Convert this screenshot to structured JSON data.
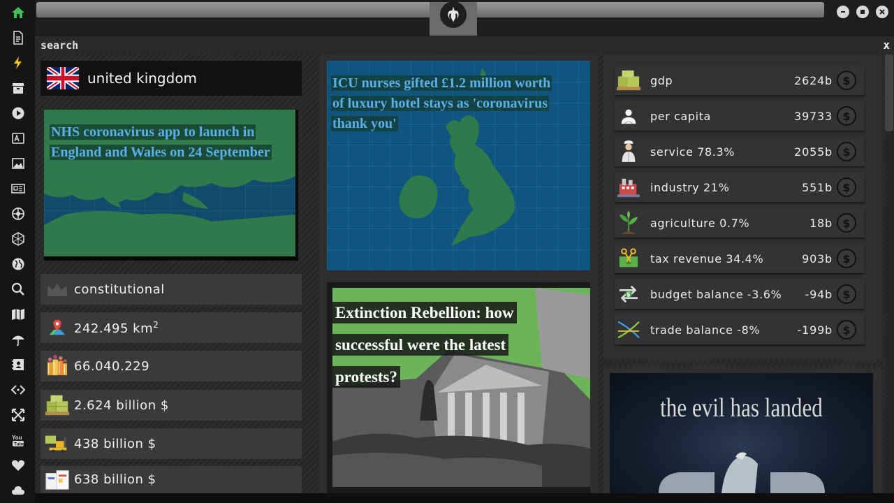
{
  "search": {
    "label": "search",
    "close": "x"
  },
  "country": {
    "name": "united kingdom"
  },
  "news": [
    {
      "headline": "NHS coronavirus app to launch in England and Wales on 24 September"
    },
    {
      "headline": "ICU nurses gifted £1.2 million worth of luxury hotel stays as 'coronavirus thank you'"
    },
    {
      "headline": "Extinction Rebellion: how successful were the latest protests?"
    }
  ],
  "stats": {
    "government": "constitutional",
    "area_value": "242.495 km",
    "area_sup": "2",
    "population": "66.040.229",
    "gdp": "2.624 billion $",
    "stat5": "438 billion $",
    "stat6": "638 billion $"
  },
  "economy": [
    {
      "icon": "money-pallet-icon",
      "label": "gdp",
      "value": "2624b"
    },
    {
      "icon": "person-icon",
      "label": "per capita",
      "value": "39733"
    },
    {
      "icon": "waiter-icon",
      "label": "service 78.3%",
      "value": "2055b"
    },
    {
      "icon": "factory-icon",
      "label": "industry 21%",
      "value": "551b"
    },
    {
      "icon": "plant-icon",
      "label": "agriculture 0.7%",
      "value": "18b"
    },
    {
      "icon": "tax-scissors-icon",
      "label": "tax revenue 34.4%",
      "value": "903b"
    },
    {
      "icon": "budget-arrows-icon",
      "label": "budget balance -3.6%",
      "value": "-94b"
    },
    {
      "icon": "trade-cross-icon",
      "label": "trade balance -8%",
      "value": "-199b"
    }
  ],
  "dollar_symbol": "$",
  "promo": {
    "title": "the evil has landed"
  },
  "colors": {
    "accent_green": "#3fbf5a",
    "headline_blue": "#5ab0e8"
  }
}
